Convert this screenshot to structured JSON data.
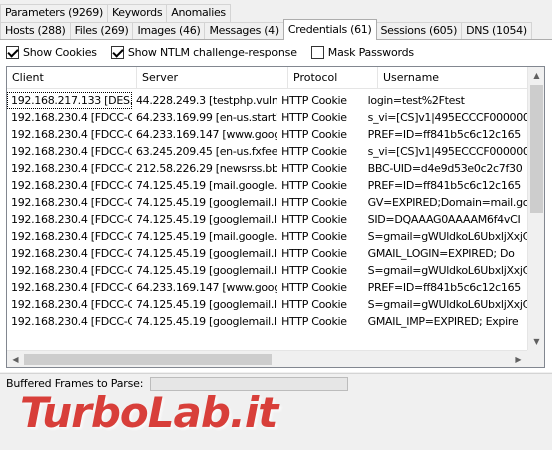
{
  "tabs_row1": [
    {
      "label": "Parameters (9269)"
    },
    {
      "label": "Keywords"
    },
    {
      "label": "Anomalies"
    }
  ],
  "tabs_row2": [
    {
      "label": "Hosts (288)"
    },
    {
      "label": "Files (269)"
    },
    {
      "label": "Images (46)"
    },
    {
      "label": "Messages (4)"
    },
    {
      "label": "Credentials (61)",
      "active": true
    },
    {
      "label": "Sessions (605)"
    },
    {
      "label": "DNS (1054)"
    }
  ],
  "options": {
    "show_cookies": {
      "label": "Show Cookies",
      "checked": true
    },
    "show_ntlm": {
      "label": "Show NTLM challenge-response",
      "checked": true
    },
    "mask_passwords": {
      "label": "Mask Passwords",
      "checked": false
    }
  },
  "table": {
    "columns": [
      "Client",
      "Server",
      "Protocol",
      "Username"
    ],
    "rows": [
      [
        "192.168.217.133 [DES...",
        "44.228.249.3 [testphp.vuln...",
        "HTTP Cookie",
        "login=test%2Ftest"
      ],
      [
        "192.168.230.4 [FDCC-C...",
        "64.233.169.99 [en-us.start2...",
        "HTTP Cookie",
        "s_vi=[CS]v1|495ECCCF000000"
      ],
      [
        "192.168.230.4 [FDCC-C...",
        "64.233.169.147 [www.goog...",
        "HTTP Cookie",
        "PREF=ID=ff841b5c6c12c165"
      ],
      [
        "192.168.230.4 [FDCC-C...",
        "63.245.209.45 [en-us.fxfee...",
        "HTTP Cookie",
        "s_vi=[CS]v1|495ECCCF000000"
      ],
      [
        "192.168.230.4 [FDCC-C...",
        "212.58.226.29 [newsrss.bb...",
        "HTTP Cookie",
        "BBC-UID=d4e9d53e0c2c7f30"
      ],
      [
        "192.168.230.4 [FDCC-C...",
        "74.125.45.19 [mail.google...",
        "HTTP Cookie",
        "PREF=ID=ff841b5c6c12c165"
      ],
      [
        "192.168.230.4 [FDCC-C...",
        "74.125.45.19 [googlemail.l...",
        "HTTP Cookie",
        "GV=EXPIRED;Domain=mail.go"
      ],
      [
        "192.168.230.4 [FDCC-C...",
        "74.125.45.19 [googlemail.l...",
        "HTTP Cookie",
        "SID=DQAAAG0AAAAM6f4vCI"
      ],
      [
        "192.168.230.4 [FDCC-C...",
        "74.125.45.19 [mail.google...",
        "HTTP Cookie",
        "S=gmail=gWUldkoL6UbxljXxjC"
      ],
      [
        "192.168.230.4 [FDCC-C...",
        "74.125.45.19 [googlemail.l...",
        "HTTP Cookie",
        "GMAIL_LOGIN=EXPIRED; Do"
      ],
      [
        "192.168.230.4 [FDCC-C...",
        "74.125.45.19 [googlemail.l...",
        "HTTP Cookie",
        "S=gmail=gWUldkoL6UbxljXxjC"
      ],
      [
        "192.168.230.4 [FDCC-C...",
        "64.233.169.147 [www.goog...",
        "HTTP Cookie",
        "PREF=ID=ff841b5c6c12c165"
      ],
      [
        "192.168.230.4 [FDCC-C...",
        "74.125.45.19 [googlemail.l...",
        "HTTP Cookie",
        "S=gmail=gWUldkoL6UbxljXxjC"
      ],
      [
        "192.168.230.4 [FDCC-C...",
        "74.125.45.19 [googlemail.l...",
        "HTTP Cookie",
        "GMAIL_IMP=EXPIRED; Expire"
      ]
    ]
  },
  "status": {
    "label": "Buffered Frames to Parse:",
    "progress": 0
  },
  "watermark": "TurboLab.it"
}
